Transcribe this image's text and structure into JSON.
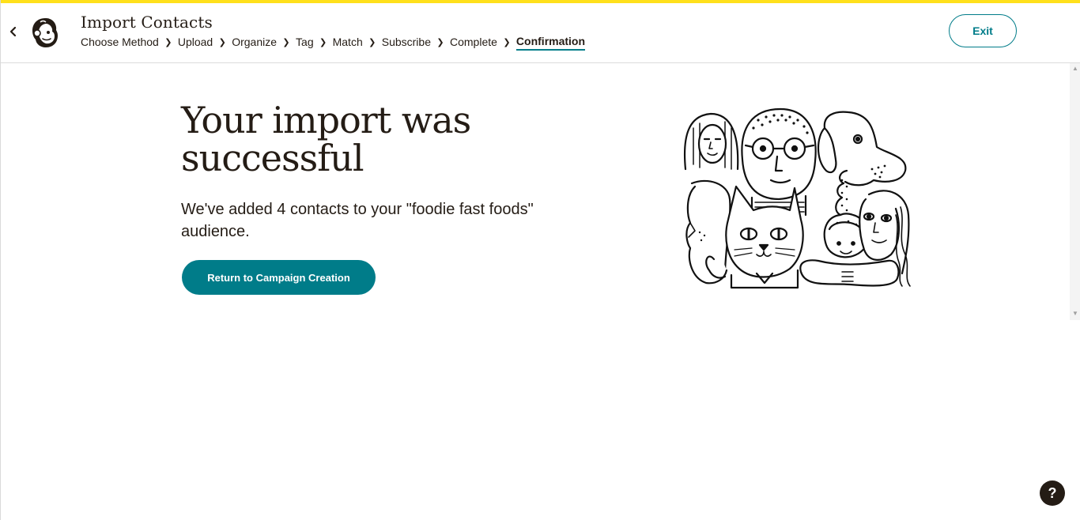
{
  "header": {
    "title": "Import Contacts",
    "exit_label": "Exit",
    "steps": [
      {
        "label": "Choose Method"
      },
      {
        "label": "Upload"
      },
      {
        "label": "Organize"
      },
      {
        "label": "Tag"
      },
      {
        "label": "Match"
      },
      {
        "label": "Subscribe"
      },
      {
        "label": "Complete"
      },
      {
        "label": "Confirmation"
      }
    ],
    "active_step": "Confirmation"
  },
  "main": {
    "headline": "Your import was successful",
    "message": "We've added 4 contacts to your \"foodie fast foods\" audience.",
    "cta_label": "Return to Campaign Creation"
  },
  "help": {
    "label": "?"
  },
  "colors": {
    "accent": "#007c89",
    "brand_yellow": "#ffe01b",
    "text": "#241c15"
  },
  "icons": [
    "back-chevron-icon",
    "mailchimp-logo-icon",
    "chevron-right-icon",
    "help-icon"
  ]
}
